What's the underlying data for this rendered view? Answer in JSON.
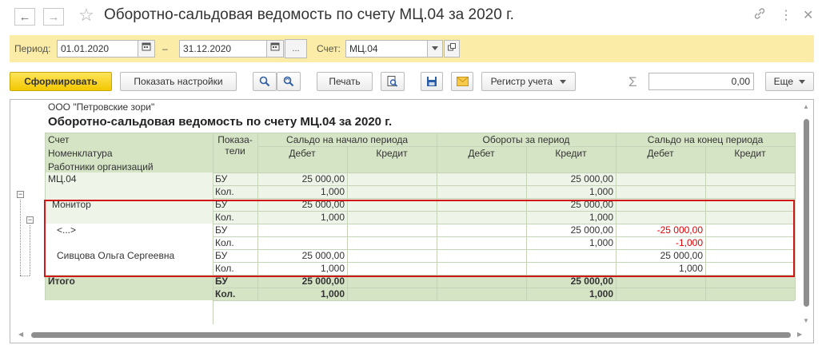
{
  "window": {
    "title": "Оборотно-сальдовая ведомость по счету МЦ.04 за 2020 г.",
    "back_icon": "←",
    "forward_icon": "→",
    "star_icon": "☆",
    "link_icon": "🔗",
    "more_icon": "⋮",
    "close_icon": "✕"
  },
  "period": {
    "label": "Период:",
    "from": "01.01.2020",
    "dash": "–",
    "to": "31.12.2020",
    "ellipsis": "...",
    "account_label": "Счет:",
    "account": "МЦ.04"
  },
  "toolbar": {
    "generate": "Сформировать",
    "show_settings": "Показать настройки",
    "print": "Печать",
    "register": "Регистр учета",
    "sum_value": "0,00",
    "more": "Еще"
  },
  "report": {
    "company": "ООО \"Петровские зори\"",
    "title": "Оборотно-сальдовая ведомость по счету МЦ.04 за 2020 г.",
    "headers": {
      "account": "Счет",
      "nomenclature": "Номенклатура",
      "employees": "Работники организаций",
      "indicators_1": "Показа-",
      "indicators_2": "тели",
      "opening": "Сальдо на начало периода",
      "turnover": "Обороты за период",
      "closing": "Сальдо на конец периода",
      "debit": "Дебет",
      "credit": "Кредит"
    },
    "rows": [
      {
        "name": "МЦ.04",
        "ind": "БУ",
        "v": [
          "25 000,00",
          "",
          "",
          "25 000,00",
          "",
          ""
        ]
      },
      {
        "name": "",
        "ind": "Кол.",
        "v": [
          "1,000",
          "",
          "",
          "1,000",
          "",
          ""
        ]
      },
      {
        "name": "Монитор",
        "ind": "БУ",
        "v": [
          "25 000,00",
          "",
          "",
          "25 000,00",
          "",
          ""
        ]
      },
      {
        "name": "",
        "ind": "Кол.",
        "v": [
          "1,000",
          "",
          "",
          "1,000",
          "",
          ""
        ]
      },
      {
        "name": "<...>",
        "ind": "БУ",
        "v": [
          "",
          "",
          "",
          "25 000,00",
          "-25 000,00",
          ""
        ]
      },
      {
        "name": "",
        "ind": "Кол.",
        "v": [
          "",
          "",
          "",
          "1,000",
          "-1,000",
          ""
        ]
      },
      {
        "name": "Сивцова Ольга Сергеевна",
        "ind": "БУ",
        "v": [
          "25 000,00",
          "",
          "",
          "",
          "25 000,00",
          ""
        ]
      },
      {
        "name": "",
        "ind": "Кол.",
        "v": [
          "1,000",
          "",
          "",
          "",
          "1,000",
          ""
        ]
      }
    ],
    "total": {
      "label": "Итого",
      "rows": [
        {
          "ind": "БУ",
          "v": [
            "25 000,00",
            "",
            "",
            "25 000,00",
            "",
            ""
          ]
        },
        {
          "ind": "Кол.",
          "v": [
            "1,000",
            "",
            "",
            "1,000",
            "",
            ""
          ]
        }
      ]
    }
  },
  "colors": {
    "period_bar": "#fbeca7",
    "header_green": "#d6e4c6",
    "highlight_red": "#d01818",
    "negative": "#e00000"
  }
}
